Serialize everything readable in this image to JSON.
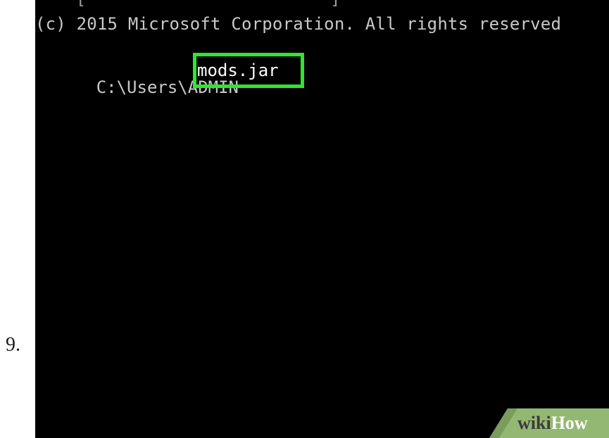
{
  "step": {
    "number": "9."
  },
  "console": {
    "copyright_line": "(c) 2015 Microsoft Corporation. All rights reserved",
    "prompt_path": "C:\\Users\\ADMIN",
    "command": "mods.jar",
    "highlight_color": "#2ee62e",
    "background_color": "#000000",
    "text_color": "#c8c8c8"
  },
  "watermark": {
    "brand_wiki": "wiki",
    "brand_how": "How",
    "brand_color": "#93b874"
  }
}
